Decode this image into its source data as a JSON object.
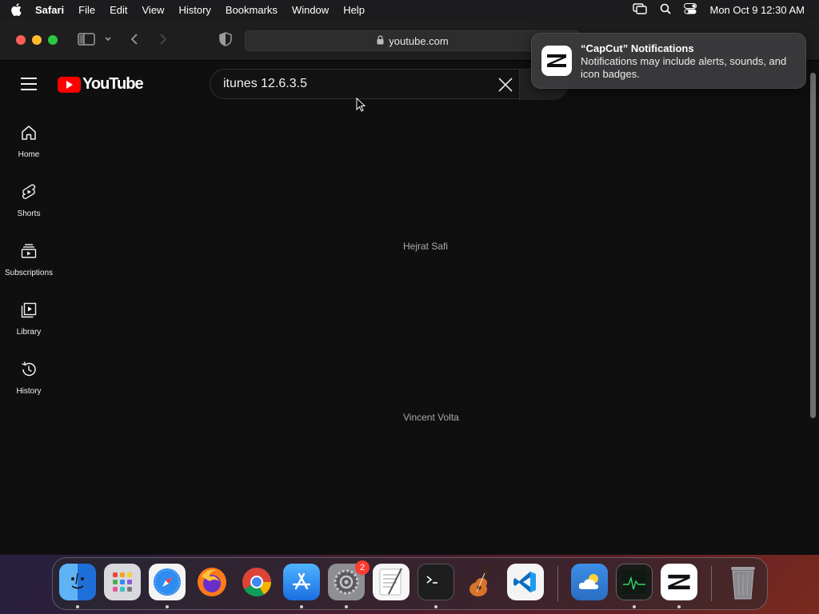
{
  "menubar": {
    "app_name": "Safari",
    "menus": [
      "File",
      "Edit",
      "View",
      "History",
      "Bookmarks",
      "Window",
      "Help"
    ],
    "datetime": "Mon Oct 9  12:30 AM"
  },
  "browser": {
    "url": "youtube.com"
  },
  "youtube": {
    "logo_text": "YouTube",
    "search": {
      "value": "itunes 12.6.3.5"
    },
    "guide": [
      {
        "label": "Home",
        "icon": "home-icon"
      },
      {
        "label": "Shorts",
        "icon": "shorts-icon"
      },
      {
        "label": "Subscriptions",
        "icon": "subscriptions-icon"
      },
      {
        "label": "Library",
        "icon": "library-icon"
      },
      {
        "label": "History",
        "icon": "history-icon"
      }
    ],
    "results": [
      {
        "channel": "Hejrat Safi"
      },
      {
        "channel": "Vincent Volta"
      }
    ]
  },
  "notification": {
    "title": "“CapCut” Notifications",
    "body": "Notifications may include alerts, sounds, and icon badges."
  },
  "dock": {
    "apps": [
      {
        "name": "Finder",
        "icon": "finder-icon"
      },
      {
        "name": "Launchpad",
        "icon": "launchpad-icon"
      },
      {
        "name": "Safari",
        "icon": "safari-icon"
      },
      {
        "name": "Firefox",
        "icon": "firefox-icon"
      },
      {
        "name": "Chrome",
        "icon": "chrome-icon"
      },
      {
        "name": "App Store",
        "icon": "app-store-icon"
      },
      {
        "name": "System Settings",
        "icon": "settings-icon",
        "badge": "2"
      },
      {
        "name": "TextEdit",
        "icon": "textedit-icon"
      },
      {
        "name": "Terminal",
        "icon": "terminal-icon"
      },
      {
        "name": "GarageBand",
        "icon": "garageband-icon"
      },
      {
        "name": "Visual Studio Code",
        "icon": "vscode-icon"
      },
      {
        "name": "Weather",
        "icon": "weather-icon"
      },
      {
        "name": "Activity Monitor",
        "icon": "activity-monitor-icon"
      },
      {
        "name": "CapCut",
        "icon": "capcut-icon"
      },
      {
        "name": "Trash",
        "icon": "trash-icon"
      }
    ]
  },
  "colors": {
    "yt_red": "#ff0000",
    "page_bg": "#0f0f0f",
    "badge_red": "#ff3b30"
  }
}
